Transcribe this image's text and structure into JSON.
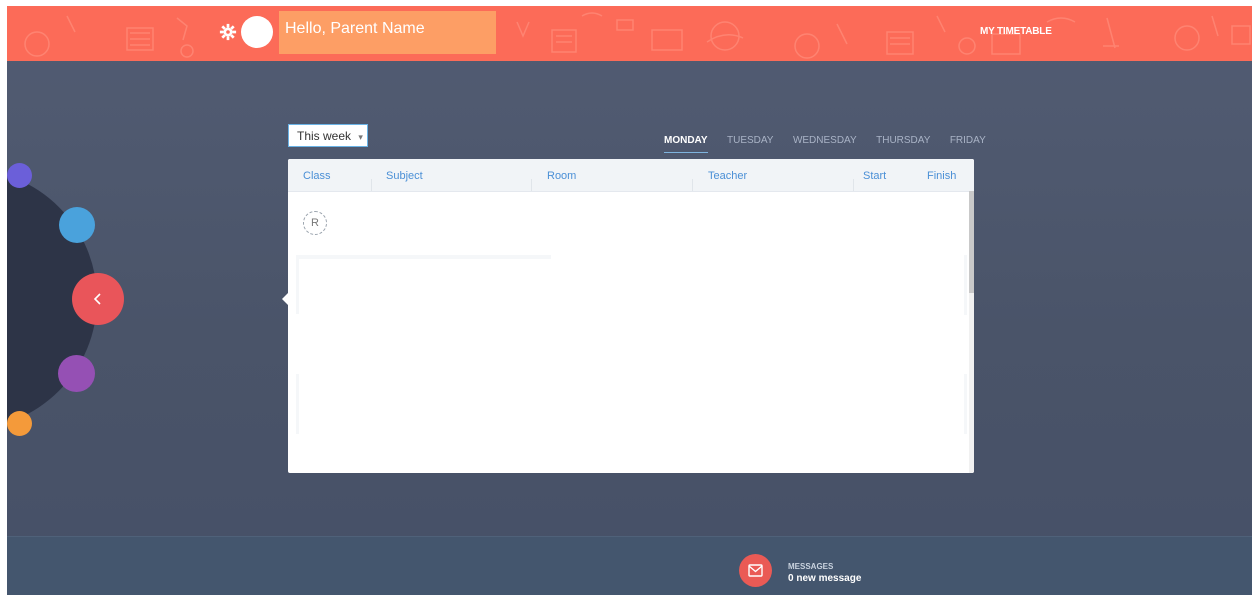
{
  "header": {
    "greeting": "Hello, Parent Name",
    "nav_title": "MY TIMETABLE",
    "brand_color": "#fc6b58",
    "greeting_bg": "#fd9e65"
  },
  "toolbar": {
    "week_select_value": "This week"
  },
  "days": [
    {
      "label": "MONDAY",
      "active": true
    },
    {
      "label": "TUESDAY",
      "active": false
    },
    {
      "label": "WEDNESDAY",
      "active": false
    },
    {
      "label": "THURSDAY",
      "active": false
    },
    {
      "label": "FRIDAY",
      "active": false
    }
  ],
  "table": {
    "columns": [
      "Class",
      "Subject",
      "Room",
      "Teacher",
      "Start",
      "Finish"
    ],
    "row_badge": "R"
  },
  "side_menu": {
    "colors": [
      "#6b5fd9",
      "#4aa2dc",
      "#e9555a",
      "#9550b4",
      "#f49a3a"
    ],
    "back_icon": "chevron-left-icon"
  },
  "footer": {
    "messages_label": "MESSAGES",
    "messages_count": "0 new message",
    "icon": "envelope-icon"
  }
}
